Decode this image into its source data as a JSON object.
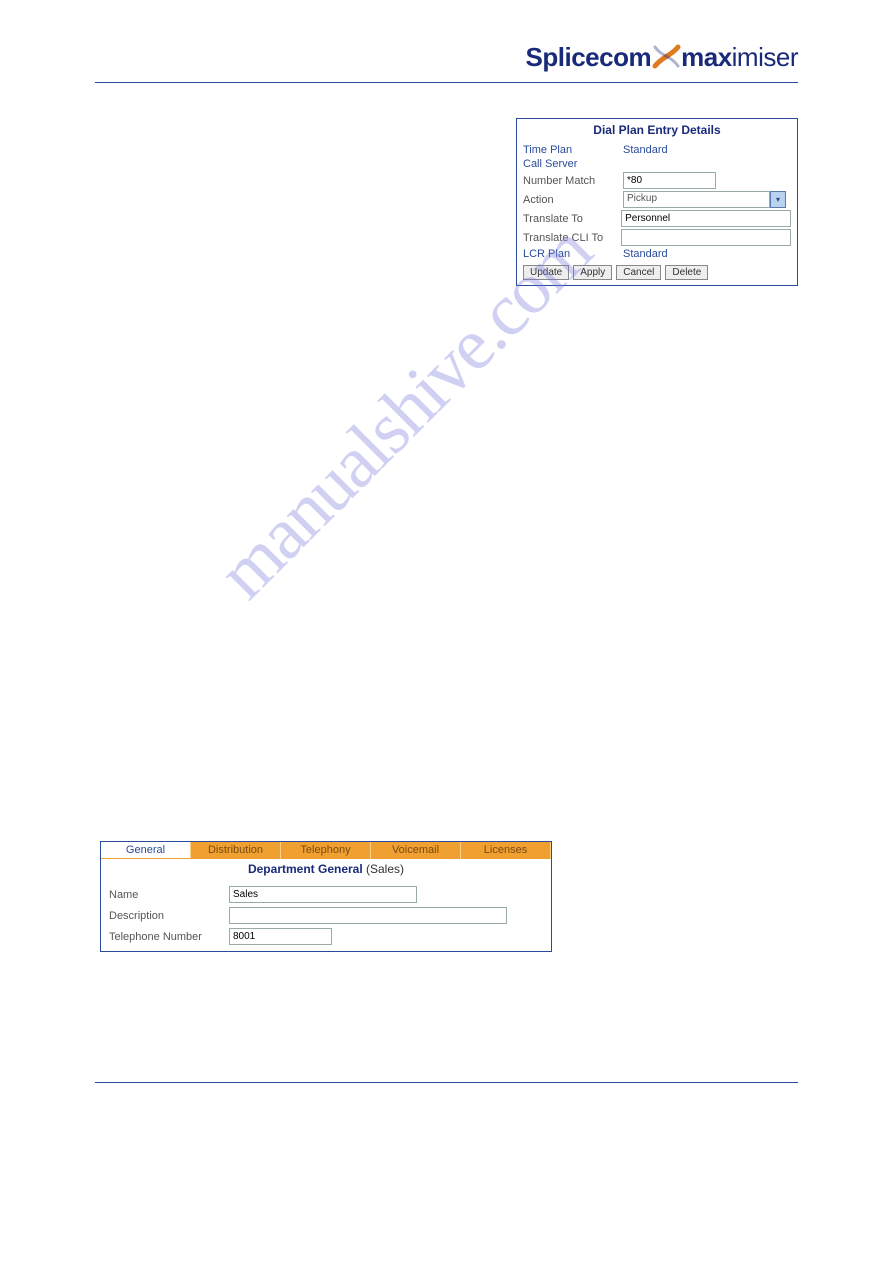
{
  "logo": {
    "part1": "Splice",
    "part2": "com",
    "part3": "max",
    "part4": "imiser"
  },
  "watermark": "manualshive.com",
  "dialPlan": {
    "title": "Dial Plan Entry Details",
    "rows": {
      "timePlan": {
        "label": "Time Plan",
        "value": "Standard"
      },
      "callServer": {
        "label": "Call Server"
      },
      "numberMatch": {
        "label": "Number Match",
        "value": "*80"
      },
      "action": {
        "label": "Action",
        "value": "Pickup"
      },
      "translateTo": {
        "label": "Translate To",
        "value": "Personnel"
      },
      "translateCliTo": {
        "label": "Translate CLI To",
        "value": ""
      },
      "lcrPlan": {
        "label": "LCR Plan",
        "value": "Standard"
      }
    },
    "buttons": {
      "update": "Update",
      "apply": "Apply",
      "cancel": "Cancel",
      "delete": "Delete"
    }
  },
  "dept": {
    "tabs": {
      "general": "General",
      "distribution": "Distribution",
      "telephony": "Telephony",
      "voicemail": "Voicemail",
      "licenses": "Licenses"
    },
    "titlePrefix": "Department General",
    "titleSuffix": " (Sales)",
    "fields": {
      "name": {
        "label": "Name",
        "value": "Sales"
      },
      "description": {
        "label": "Description",
        "value": ""
      },
      "telephone": {
        "label": "Telephone Number",
        "value": "8001"
      }
    }
  }
}
